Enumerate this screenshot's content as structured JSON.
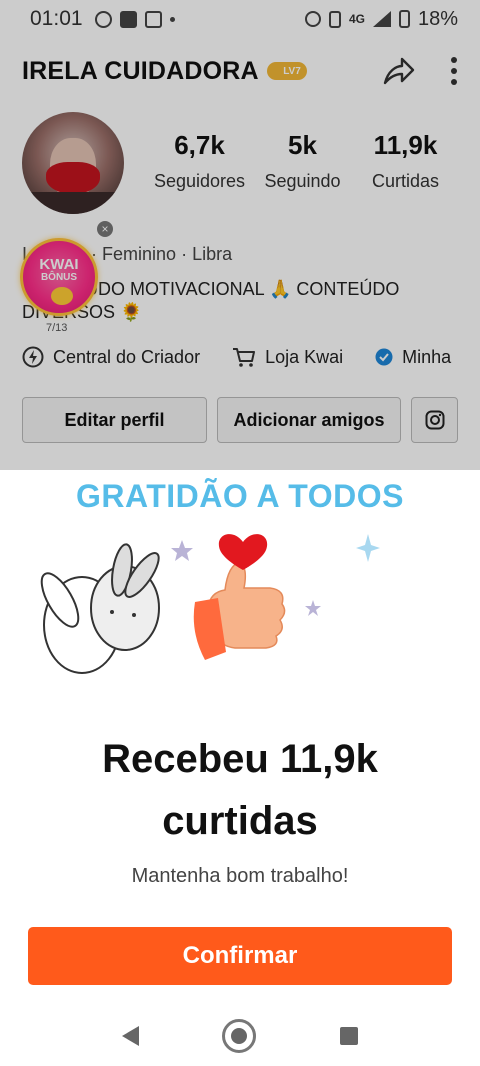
{
  "status_bar": {
    "time": "01:01",
    "network": "4G",
    "battery": "18%"
  },
  "profile": {
    "name": "IRELA CUIDADORA",
    "level": "LV7",
    "stats": [
      {
        "value": "6,7k",
        "label": "Seguidores"
      },
      {
        "value": "5k",
        "label": "Seguindo"
      },
      {
        "value": "11,9k",
        "label": "Curtidas"
      }
    ],
    "meta": "I...ela13 · Feminino · Libra",
    "bio": "CONTEÚDO MOTIVACIONAL 🙏 CONTEÚDO DIVERSOS 🌻",
    "kwai_bonus": {
      "line1": "KWAI",
      "line2": "BÔNUS",
      "progress": "7/13"
    },
    "quick_links": [
      "Central do Criador",
      "Loja Kwai",
      "Minha"
    ],
    "buttons": {
      "edit": "Editar perfil",
      "add_friends": "Adicionar amigos"
    }
  },
  "sheet": {
    "title": "GRATIDÃO A TODOS",
    "headline": "Recebeu 11,9k curtidas",
    "subline": "Mantenha bom trabalho!",
    "confirm_label": "Confirmar"
  },
  "colors": {
    "title_blue": "#56bce8",
    "confirm_orange": "#ff5a1b",
    "heart_red": "#e2181f"
  },
  "icons": [
    "whatsapp-icon",
    "facebook-icon",
    "mail-icon",
    "alarm-icon",
    "vibrate-icon",
    "signal-icon",
    "battery-icon",
    "share-icon",
    "more-icon",
    "bolt-icon",
    "cart-icon",
    "verified-icon",
    "instagram-icon",
    "back-icon",
    "home-icon",
    "recents-icon"
  ]
}
